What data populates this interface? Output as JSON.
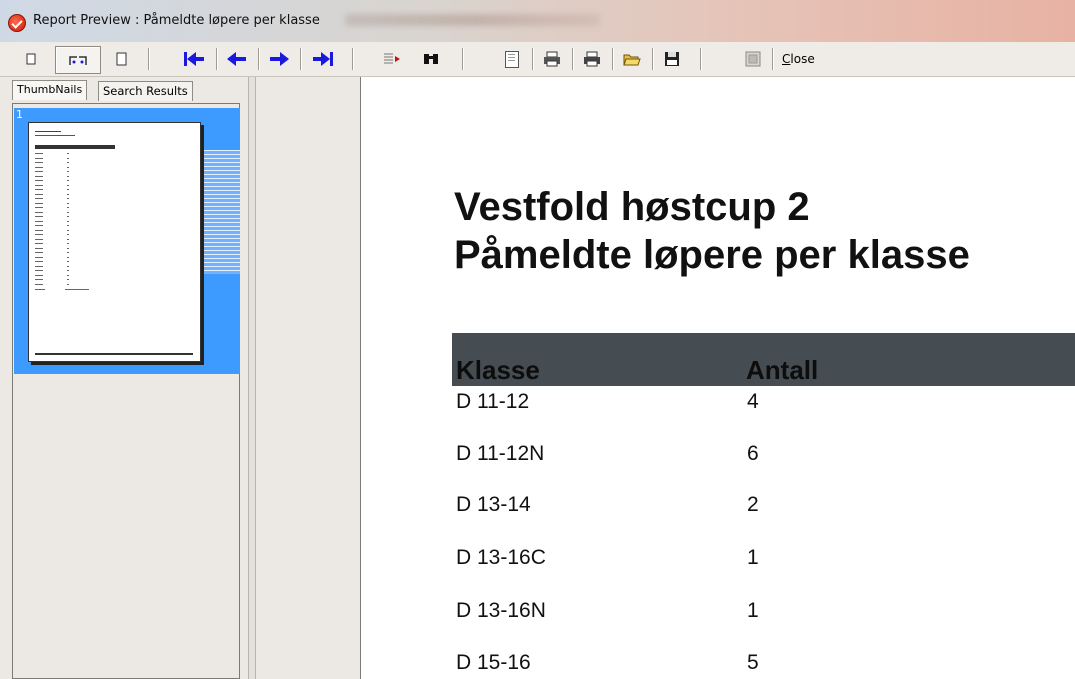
{
  "window": {
    "title": "Report Preview : Påmeldte løpere per klasse"
  },
  "toolbar": {
    "close_label": "Close",
    "close_mnemonic": "C",
    "close_rest": "lose"
  },
  "left_panel": {
    "tabs": [
      {
        "label": "ThumbNails"
      },
      {
        "label": "Search Results"
      }
    ],
    "thumbnail_page_number": "1"
  },
  "report": {
    "title_line1": "Vestfold høstcup 2",
    "title_line2": "Påmeldte løpere per klasse",
    "columns": [
      "Klasse",
      "Antall"
    ],
    "rows": [
      {
        "klasse": "D 11-12",
        "antall": "4"
      },
      {
        "klasse": "D 11-12N",
        "antall": "6"
      },
      {
        "klasse": "D 13-14",
        "antall": "2"
      },
      {
        "klasse": "D 13-16C",
        "antall": "1"
      },
      {
        "klasse": "D 13-16N",
        "antall": "1"
      },
      {
        "klasse": "D 15-16",
        "antall": "5"
      }
    ]
  },
  "colors": {
    "header_bg": "#454d52",
    "thumbnail_selection": "#3d9bff",
    "nav_arrows": "#1b18e0"
  }
}
